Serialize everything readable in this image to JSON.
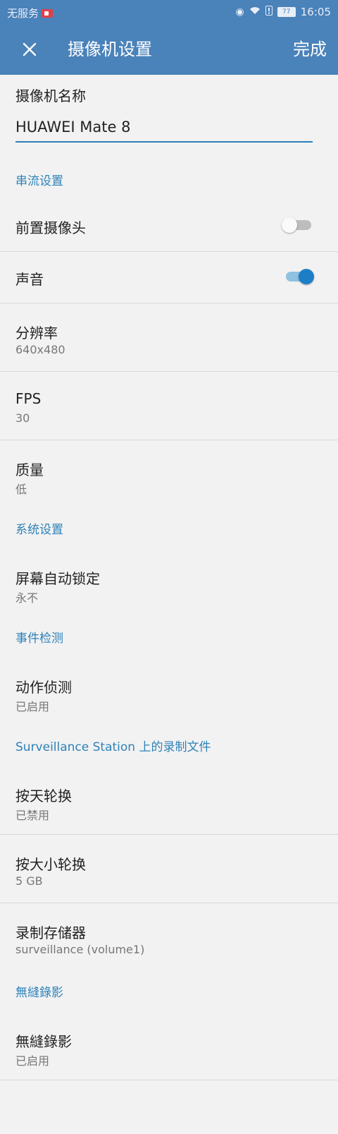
{
  "status_bar": {
    "carrier": "无服务",
    "battery": "77",
    "time": "16:05",
    "icons": [
      "eye-icon",
      "wifi-icon",
      "alert-icon"
    ]
  },
  "app_bar": {
    "close_icon": "close-icon",
    "title": "摄像机设置",
    "done_label": "完成"
  },
  "camera_name": {
    "label": "摄像机名称",
    "value": "HUAWEI Mate 8"
  },
  "sections": {
    "streaming": {
      "header": "串流设置",
      "front_camera": {
        "label": "前置摄像头",
        "enabled": false
      },
      "audio": {
        "label": "声音",
        "enabled": true
      },
      "resolution": {
        "label": "分辨率",
        "value": "640x480"
      },
      "fps": {
        "label": "FPS",
        "value": "30"
      },
      "quality": {
        "label": "质量",
        "value": "低"
      }
    },
    "system": {
      "header": "系统设置",
      "auto_lock": {
        "label": "屏幕自动锁定",
        "value": "永不"
      }
    },
    "events": {
      "header": "事件检测",
      "motion": {
        "label": "动作侦测",
        "value": "已启用"
      }
    },
    "recordings": {
      "header": "Surveillance Station 上的录制文件",
      "rotate_by_day": {
        "label": "按天轮换",
        "value": "已禁用"
      },
      "rotate_by_size": {
        "label": "按大小轮换",
        "value": "5 GB"
      },
      "storage": {
        "label": "录制存储器",
        "value": "surveillance (volume1)"
      }
    },
    "seamless": {
      "header": "無縫錄影",
      "seamless_recording": {
        "label": "無縫錄影",
        "value": "已启用"
      }
    }
  },
  "colors": {
    "app_bar": "#4a82ba",
    "accent": "#2e82b8",
    "toggle_on": "#1c7fc6",
    "background": "#f2f2f2"
  }
}
